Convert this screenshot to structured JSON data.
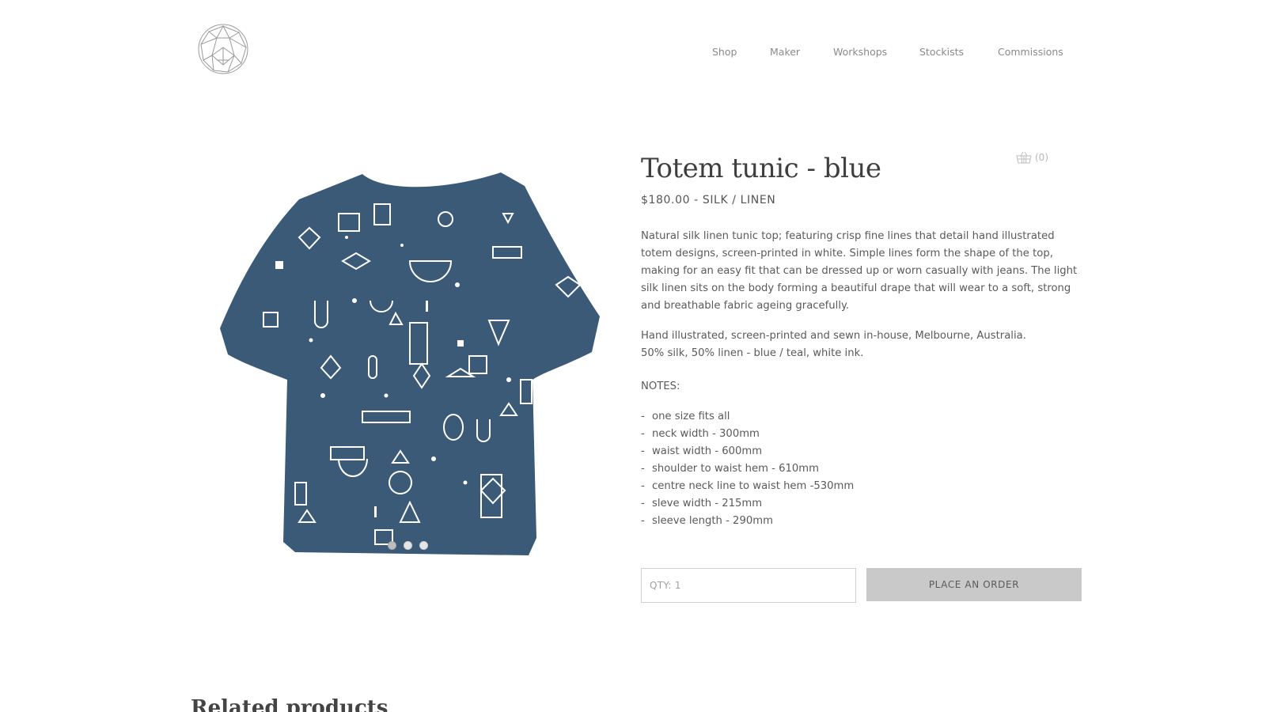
{
  "brand": {
    "logo_icon": "geometric-gem-logo-icon"
  },
  "nav": {
    "items": [
      {
        "label": "Shop"
      },
      {
        "label": "Maker"
      },
      {
        "label": "Workshops"
      },
      {
        "label": "Stockists"
      },
      {
        "label": "Commissions"
      }
    ]
  },
  "cart": {
    "icon": "basket-icon",
    "count": "(0)"
  },
  "product": {
    "title": "Totem tunic - blue",
    "price_line": "$180.00 - SILK / LINEN",
    "description": "Natural silk linen tunic top; featuring crisp fine lines that detail hand illustrated totem designs, screen-printed in white. Simple lines form the shape of the top, making for an easy fit that can be dressed up or worn casually with jeans. The light silk linen sits on the body forming a beautiful drape that will wear to a soft, strong and breathable fabric ageing gracefully.",
    "made_in": "Hand illustrated, screen-printed and sewn in-house, Melbourne, Australia.",
    "composition": "50% silk, 50% linen - blue / teal, white ink.",
    "notes_label": "NOTES:",
    "notes": [
      "one size fits all",
      "neck width - 300mm",
      "waist width - 600mm",
      "shoulder to waist hem - 610mm",
      "centre neck line to waist hem -530mm",
      "sleve width - 215mm",
      "sleeve length - 290mm"
    ],
    "image": {
      "icon": "tunic-product-image",
      "garment_color": "#3a5a78",
      "print_color": "#ffffff"
    },
    "carousel": {
      "count": 3,
      "active_index": 0
    }
  },
  "order": {
    "qty_value": "QTY: 1",
    "button_label": "PLACE AN ORDER"
  },
  "related": {
    "heading": "Related products"
  }
}
